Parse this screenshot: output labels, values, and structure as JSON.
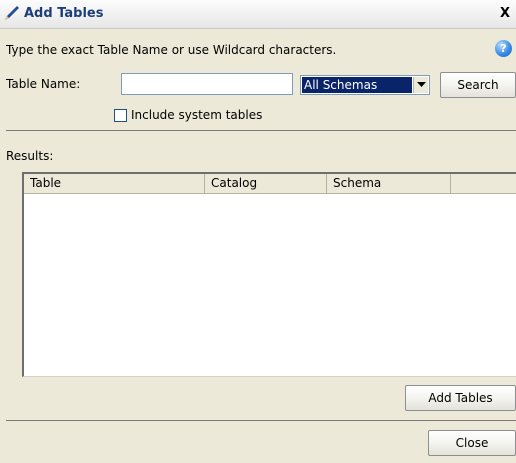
{
  "window": {
    "title": "Add Tables",
    "close_glyph": "X"
  },
  "form": {
    "instruction": "Type the exact Table Name or use Wildcard characters.",
    "help_glyph": "?",
    "table_name_label": "Table Name:",
    "table_name_value": "",
    "schema_selected": "All Schemas",
    "search_label": "Search",
    "include_system_label": "Include system tables",
    "include_system_checked": false
  },
  "results": {
    "label": "Results:",
    "columns": [
      "Table",
      "Catalog",
      "Schema",
      ""
    ],
    "rows": []
  },
  "footer": {
    "add_tables_label": "Add Tables",
    "close_label": "Close"
  },
  "colors": {
    "title_text": "#1c3f7a",
    "selection": "#0a246a",
    "window_bg": "#ece9d8"
  },
  "icons": {
    "title": "pencil-icon",
    "help": "help-icon",
    "dropdown": "chevron-down-icon"
  }
}
